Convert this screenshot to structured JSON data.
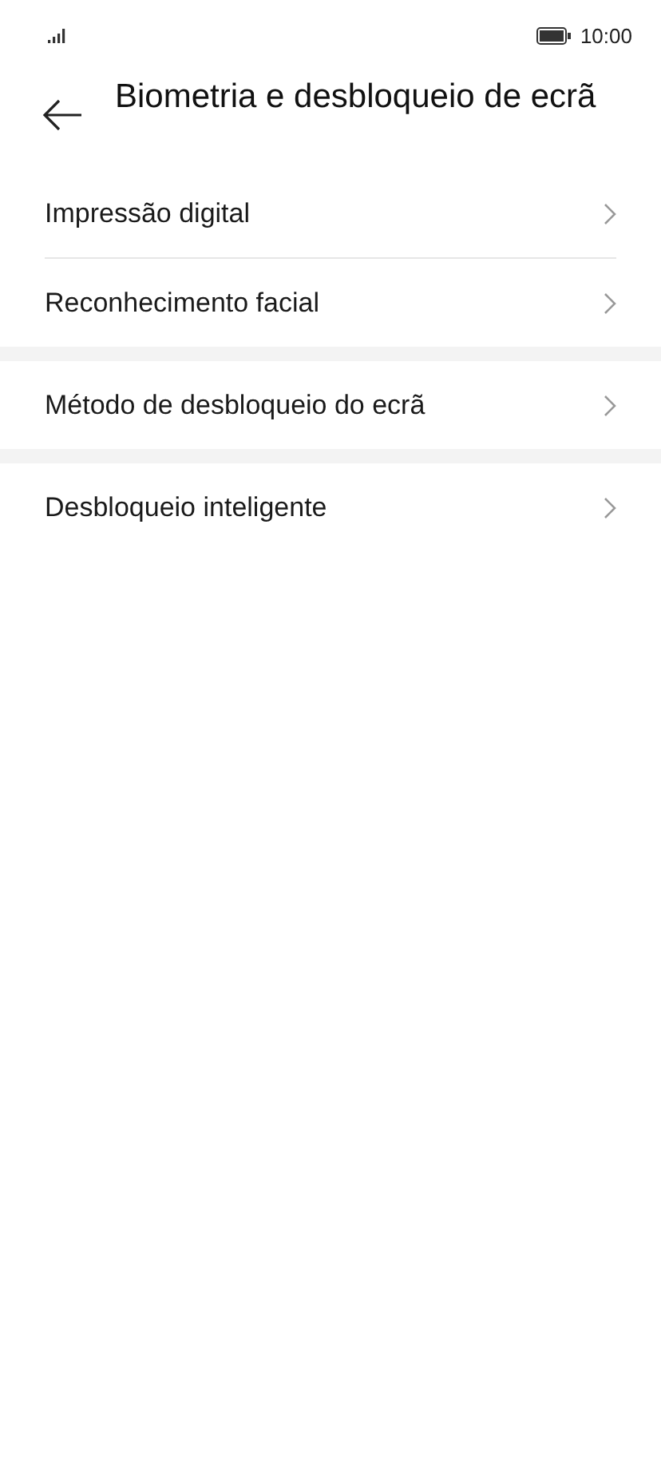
{
  "status_bar": {
    "time": "10:00"
  },
  "header": {
    "title": "Biometria e desbloqueio de ecrã"
  },
  "groups": [
    {
      "items": [
        "Impressão digital",
        "Reconhecimento facial"
      ]
    },
    {
      "items": [
        "Método de desbloqueio do ecrã"
      ]
    },
    {
      "items": [
        "Desbloqueio inteligente"
      ]
    }
  ]
}
